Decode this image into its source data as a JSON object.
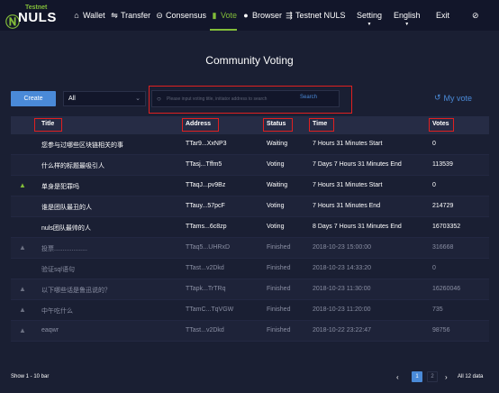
{
  "brand": {
    "testnet_tag": "Testnet",
    "name": "NULS"
  },
  "nav": {
    "items": [
      {
        "icon": "home-icon",
        "glyph": "⌂",
        "label": "Wallet"
      },
      {
        "icon": "transfer-icon",
        "glyph": "⇋",
        "label": "Transfer"
      },
      {
        "icon": "consensus-icon",
        "glyph": "⊝",
        "label": "Consensus"
      },
      {
        "icon": "vote-icon",
        "glyph": "▮",
        "label": "Vote"
      },
      {
        "icon": "browser-icon",
        "glyph": "●",
        "label": "Browser"
      },
      {
        "icon": "testnet-icon",
        "glyph": "⇶",
        "label": "Testnet NULS"
      }
    ],
    "setting": "Setting",
    "language": "English",
    "exit": "Exit",
    "help_glyph": "⊘"
  },
  "page": {
    "title": "Community Voting"
  },
  "toolbar": {
    "create_label": "Create",
    "filter_value": "All",
    "search_placeholder": "Please input voting title, initiator address to search",
    "search_button": "Search",
    "my_vote_label": "My vote"
  },
  "table": {
    "headers": {
      "title": "Title",
      "address": "Address",
      "status": "Status",
      "time": "Time",
      "votes": "Votes"
    },
    "rows": [
      {
        "icon": "",
        "title": "您参与过哪些区块链相关的事",
        "address": "TTar9...XxNP3",
        "status": "Waiting",
        "time": "7 Hours 31 Minutes Start",
        "votes": "0"
      },
      {
        "icon": "",
        "title": "什么样的标题最吸引人",
        "address": "TTasj...Tffm5",
        "status": "Voting",
        "time": "7 Days 7 Hours 31 Minutes End",
        "votes": "113539"
      },
      {
        "icon": "green",
        "title": "单身是犯罪吗",
        "address": "TTaqJ...pv9Bz",
        "status": "Waiting",
        "time": "7 Hours 31 Minutes Start",
        "votes": "0"
      },
      {
        "icon": "",
        "title": "谁是团队最丑的人",
        "address": "TTauy...57pcF",
        "status": "Voting",
        "time": "7 Hours 31 Minutes End",
        "votes": "214729"
      },
      {
        "icon": "",
        "title": "nuls团队最帅的人",
        "address": "TTams...6c8zp",
        "status": "Voting",
        "time": "8 Days 7 Hours 31 Minutes End",
        "votes": "16703352"
      },
      {
        "icon": "grey",
        "title": "投票...................",
        "address": "TTaq5...UHRxD",
        "status": "Finished",
        "time": "2018-10-23 15:00:00",
        "votes": "316668"
      },
      {
        "icon": "",
        "title": "验证sql语句",
        "address": "TTast...v2Dkd",
        "status": "Finished",
        "time": "2018-10-23 14:33:20",
        "votes": "0"
      },
      {
        "icon": "grey",
        "title": "以下哪些话是鲁迅说的？",
        "address": "TTapk...TrTRq",
        "status": "Finished",
        "time": "2018-10-23 11:30:00",
        "votes": "16260046"
      },
      {
        "icon": "grey",
        "title": "中午吃什么",
        "address": "TTamC...TqVGW",
        "status": "Finished",
        "time": "2018-10-23 11:20:00",
        "votes": "735"
      },
      {
        "icon": "grey",
        "title": "eaqwr",
        "address": "TTast...v2Dkd",
        "status": "Finished",
        "time": "2018-10-22 23:22:47",
        "votes": "98756"
      }
    ]
  },
  "footer": {
    "show_text": "Show 1 - 10 bar",
    "current_page": "1",
    "next_page": "2",
    "total_text": "All 12 data"
  },
  "colors": {
    "accent_green": "#82bd39",
    "accent_blue": "#4a8ad8",
    "highlight_red": "#e02020",
    "background": "#1a1f33"
  }
}
